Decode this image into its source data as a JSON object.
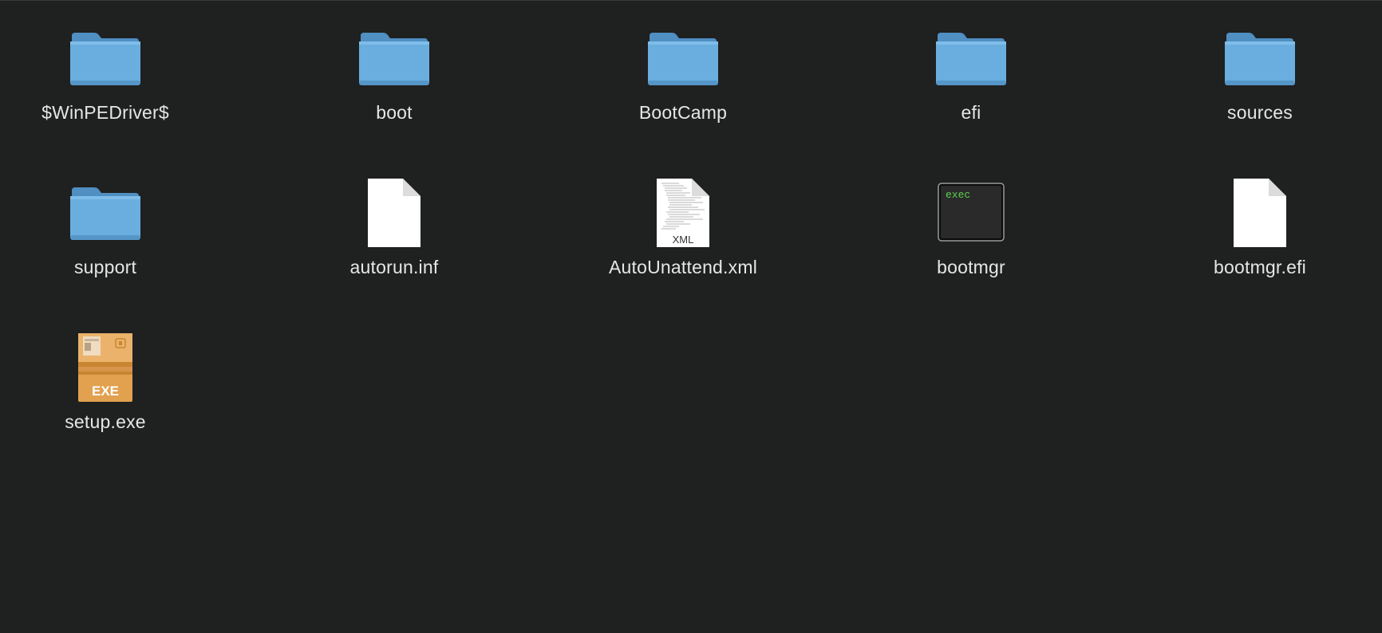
{
  "window": {
    "background": "#1f2020",
    "label_color": "#e6e6e6"
  },
  "items": [
    {
      "name": "$WinPEDriver$",
      "kind": "folder",
      "icon": "folder-icon"
    },
    {
      "name": "boot",
      "kind": "folder",
      "icon": "folder-icon"
    },
    {
      "name": "BootCamp",
      "kind": "folder",
      "icon": "folder-icon"
    },
    {
      "name": "efi",
      "kind": "folder",
      "icon": "folder-icon"
    },
    {
      "name": "sources",
      "kind": "folder",
      "icon": "folder-icon"
    },
    {
      "name": "support",
      "kind": "folder",
      "icon": "folder-icon"
    },
    {
      "name": "autorun.inf",
      "kind": "document",
      "icon": "blank-document-icon"
    },
    {
      "name": "AutoUnattend.xml",
      "kind": "document",
      "icon": "xml-document-icon",
      "badge": "XML"
    },
    {
      "name": "bootmgr",
      "kind": "executable",
      "icon": "terminal-exec-icon",
      "badge": "exec"
    },
    {
      "name": "bootmgr.efi",
      "kind": "document",
      "icon": "blank-document-icon"
    },
    {
      "name": "setup.exe",
      "kind": "application",
      "icon": "exe-package-icon",
      "badge": "EXE"
    }
  ],
  "colors": {
    "folder_body": "#6aaee0",
    "folder_tab": "#5b9bcc",
    "exe_box": "#e2a14e",
    "exec_text": "#5ed14e"
  }
}
